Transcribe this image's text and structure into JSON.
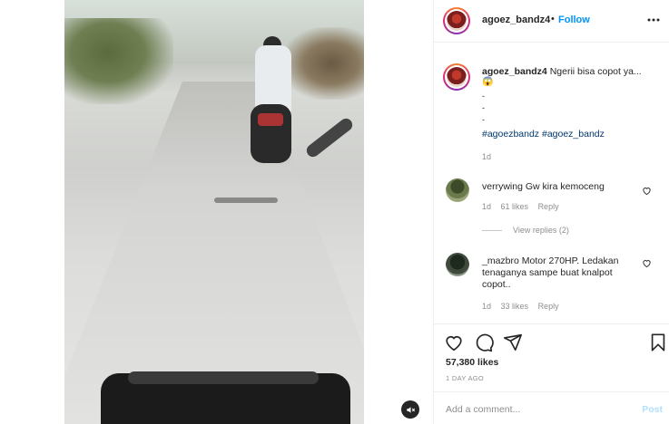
{
  "post": {
    "username": "agoez_bandz4",
    "separator": "•",
    "follow_label": "Follow"
  },
  "caption": {
    "username": "agoez_bandz4",
    "text": "Ngerii bisa copot ya...",
    "emoji": "😱",
    "dots": [
      "-",
      "-",
      "-"
    ],
    "hashtags": "#agoezbandz #agoez_bandz",
    "time": "1d"
  },
  "comments": [
    {
      "username": "verrywing",
      "text": "Gw kira kemoceng",
      "time": "1d",
      "likes": "61 likes",
      "reply_label": "Reply",
      "view_replies": "View replies (2)"
    },
    {
      "username": "_mazbro",
      "text": "Motor 270HP. Ledakan tenaganya sampe buat knalpot copot..",
      "time": "1d",
      "likes": "33 likes",
      "reply_label": "Reply"
    }
  ],
  "stats": {
    "likes": "57,380 likes",
    "posted": "1 DAY AGO"
  },
  "add_comment": {
    "placeholder": "Add a comment...",
    "post_label": "Post"
  },
  "colors": {
    "accent": "#0095f6",
    "muted": "#8e8e8e",
    "hashtag": "#00376b",
    "post_disabled": "#b2dffc"
  },
  "icons": {
    "mute": "mute-icon",
    "more": "more-options-icon",
    "like": "heart-icon",
    "comment": "comment-icon",
    "share": "share-icon",
    "save": "bookmark-icon"
  }
}
